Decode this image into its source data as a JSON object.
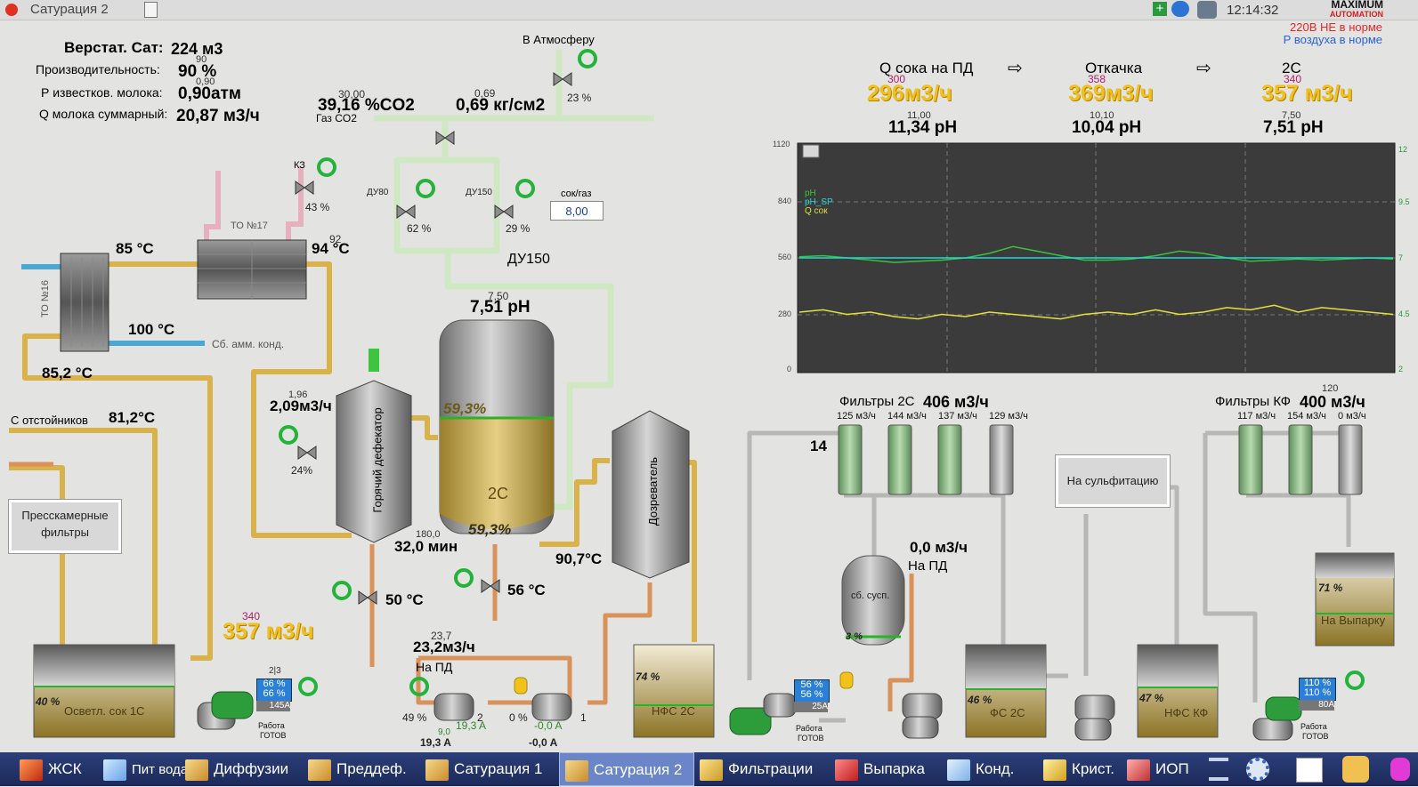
{
  "window": {
    "title": "Сатурация 2",
    "clock": "12:14:32",
    "logo_line1": "MAXIMUM",
    "logo_line2": "AUTOMATION"
  },
  "alarms": {
    "power": "220В НЕ в норме",
    "air": "Р воздуха в норме"
  },
  "colors": {
    "pipe_gold": "#d9b24a",
    "pipe_lightgreen": "#cfe8c3",
    "pipe_grey": "#b7b7b7",
    "pipe_copper": "#d9935a",
    "accent_yellow": "#f0c020",
    "trend_bg": "#3b3b3b",
    "taskbar": "#22336a"
  },
  "summary": {
    "verstat_label": "Верстат. Сат:",
    "verstat_value": "224 м3",
    "productivity_label": "Производительность:",
    "productivity_sp": "90",
    "productivity_value": "90 %",
    "lime_pressure_label": "Р известков. молока:",
    "lime_pressure_sp": "0,90",
    "lime_pressure_value": "0,90атм",
    "milk_flow_label": "Q молока суммарный:",
    "milk_flow_value": "20,87 м3/ч"
  },
  "gas": {
    "co2_sp": "30,00",
    "co2_value": "39,16 %CO2",
    "co2_label": "Газ CO2",
    "pressure_sp": "0,69",
    "pressure_value": "0,69 кг/см2",
    "atmosphere_label": "В Атмосферу",
    "atm_valve_pct": "23 %",
    "du80_label": "ДУ80",
    "du80_pct": "62 %",
    "du150_label": "ДУ150",
    "du150_pct": "29 %",
    "du150_main_label": "ДУ150",
    "ratio_label": "сок/газ",
    "ratio_value": "8,00"
  },
  "heat": {
    "kz_label": "КЗ",
    "kz_pct": "43 %",
    "to17_label": "ТО №17",
    "to16_label": "ТО №16",
    "t85": "85 °C",
    "t94_sp": "92",
    "t94": "94 °C",
    "t100": "100 °C",
    "amm_label": "Сб. амм. конд.",
    "t852": "85,2 °C",
    "settler_label": "С отстойников",
    "t812": "81,2°C"
  },
  "defecator": {
    "label": "Горячий дефекатор",
    "flow_sp": "1,96",
    "flow": "2,09м3/ч",
    "valve_pct": "24%",
    "time_sp": "180,0",
    "time": "32,0 мин",
    "t_out": "50 °C"
  },
  "saturator": {
    "ph_sp": "7,50",
    "ph": "7,51 pH",
    "label": "2С",
    "level_top": "59,3%",
    "level_bottom": "59,3%",
    "t_out": "56 °C"
  },
  "maturer": {
    "label": "Дозреватель",
    "temp": "90,7°C"
  },
  "juice1": {
    "sp": "340",
    "flow": "357 м3/ч"
  },
  "tanks": {
    "osvetl": {
      "label": "Осветл. сок 1С",
      "pct": "40 %"
    },
    "nfs2c": {
      "label": "НФС 2С",
      "pct": "74 %"
    },
    "fs2c": {
      "label": "ФС 2С",
      "pct": "46 %"
    },
    "nfskf": {
      "label": "НФС КФ",
      "pct": "47 %"
    },
    "vyparka": {
      "label": "На Выпарку",
      "pct": "71 %"
    },
    "susp": {
      "label": "сб. сусп.",
      "pct": "3 %"
    }
  },
  "press_filters": {
    "line1": "Пресскамерные",
    "line2": "фильтры"
  },
  "pumps_pd": {
    "sp": "23,7",
    "flow": "23,2м3/ч",
    "label": "На ПД",
    "p1_pct": "49 %",
    "p1_sp": "9,0",
    "p1_current": "19,3 A",
    "p1_current2": "19,3 A",
    "p1_num": "2",
    "p2_pct": "0 %",
    "p2_current": "-0,0 A",
    "p2_current2": "-0,0 A",
    "p2_num": "1"
  },
  "vfd1": {
    "top": "2|3",
    "l1": "66 %",
    "l2": "66 %",
    "amps": "145A",
    "status1": "Работа",
    "status2": "ГОТОВ"
  },
  "vfd2": {
    "l1": "56 %",
    "l2": "56 %",
    "amps": "25A",
    "status1": "Работа",
    "status2": "ГОТОВ"
  },
  "vfd3": {
    "l1": "110 %",
    "l2": "110 %",
    "amps": "80A",
    "status1": "Работа",
    "status2": "ГОТОВ"
  },
  "flows_top": {
    "pd_label": "Q сока на ПД",
    "pd_sp": "300",
    "pd_value": "296м3/ч",
    "pd_ph_sp": "11,00",
    "pd_ph": "11,34 pH",
    "otk_label": "Откачка",
    "otk_sp": "358",
    "otk_value": "369м3/ч",
    "otk_ph_sp": "10,10",
    "otk_ph": "10,04 pH",
    "c2_label": "2С",
    "c2_sp": "340",
    "c2_value": "357 м3/ч",
    "c2_ph_sp": "7,50",
    "c2_ph": "7,51 pH"
  },
  "trend": {
    "left_ticks": [
      "1120",
      "840",
      "560",
      "280",
      "0"
    ],
    "right_ticks": [
      "12",
      "9.5",
      "7",
      "4.5",
      "2"
    ],
    "legend": [
      "pH",
      "pH_SP",
      "Q сок"
    ],
    "legend_colors": [
      "#39c33c",
      "#2bd6d6",
      "#e4df3e"
    ]
  },
  "chart_data": {
    "type": "line",
    "title": "",
    "left_axis_ticks": [
      1120,
      840,
      560,
      280,
      0
    ],
    "right_axis_ticks": [
      12,
      9.5,
      7,
      4.5,
      2
    ],
    "ylim": [
      2,
      12
    ],
    "grid": true,
    "legend": "top-left",
    "x": [
      0,
      4,
      8,
      12,
      16,
      20,
      24,
      28,
      32,
      36,
      40,
      44,
      48,
      52,
      56,
      60,
      64,
      68,
      72,
      76,
      80,
      84,
      88,
      92,
      96,
      100
    ],
    "series": [
      {
        "name": "pH",
        "color": "#39c33c",
        "values": [
          7.05,
          7.1,
          7.0,
          6.9,
          6.8,
          6.85,
          6.9,
          7.0,
          7.2,
          7.5,
          7.3,
          7.1,
          6.9,
          6.9,
          6.95,
          7.1,
          7.3,
          7.2,
          7.0,
          6.85,
          6.9,
          6.95,
          6.9,
          6.95,
          7.0,
          6.95
        ]
      },
      {
        "name": "pH_SP",
        "color": "#2bd6d6",
        "values": [
          7.0,
          7.0,
          7.0,
          7.0,
          7.0,
          7.0,
          7.0,
          7.0,
          7.0,
          7.0,
          7.0,
          7.0,
          7.0,
          7.0,
          7.0,
          7.0,
          7.0,
          7.0,
          7.0,
          7.0,
          7.0,
          7.0,
          7.0,
          7.0,
          7.0,
          7.0
        ]
      },
      {
        "name": "Q сок",
        "color": "#e4df3e",
        "values": [
          4.6,
          4.7,
          4.5,
          4.6,
          4.4,
          4.3,
          4.5,
          4.4,
          4.6,
          4.5,
          4.4,
          4.3,
          4.5,
          4.6,
          4.5,
          4.7,
          4.5,
          4.6,
          4.8,
          4.7,
          4.9,
          4.6,
          4.8,
          4.7,
          4.6,
          4.5
        ]
      }
    ]
  },
  "filters2c": {
    "label": "Фильтры 2С",
    "flow": "406 м3/ч",
    "f1": "125 м3/ч",
    "f2": "144 м3/ч",
    "f3": "137 м3/ч",
    "f4": "129 м3/ч",
    "count": "14"
  },
  "filterskf": {
    "label": "Фильтры КФ",
    "sp": "120",
    "flow": "400 м3/ч",
    "f1": "117 м3/ч",
    "f2": "154 м3/ч",
    "f3": "0 м3/ч"
  },
  "pd_right": {
    "flow": "0,0 м3/ч",
    "label": "На ПД"
  },
  "sulfit_button": "На сульфитацию",
  "taskbar": {
    "items": [
      "ЖСК",
      "Пит вода",
      "Диффузии",
      "Преддеф.",
      "Сатурация 1",
      "Сатурация 2",
      "Фильтрации",
      "Выпарка",
      "Конд.",
      "Крист.",
      "ИОП"
    ]
  }
}
